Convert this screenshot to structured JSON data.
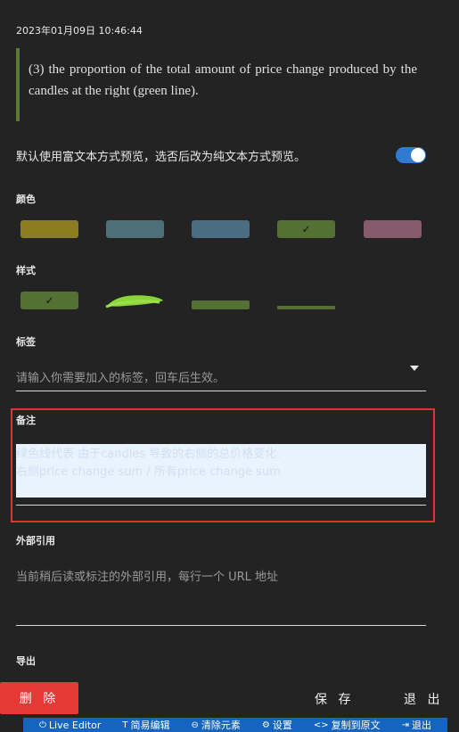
{
  "timestamp": "2023年01月09日 10:46:44",
  "quote": "(3) the proportion of the total amount of price change produced by the candles at the right (green line).",
  "preview_pref": {
    "text": "默认使用富文本方式预览，选否后改为纯文本方式预览。",
    "enabled": true
  },
  "colors_section": {
    "label": "颜色",
    "swatches": [
      {
        "name": "olive",
        "color": "#8a7d22",
        "selected": false
      },
      {
        "name": "slate-teal",
        "color": "#4d6f78",
        "selected": false
      },
      {
        "name": "steel-blue",
        "color": "#4b6d84",
        "selected": false
      },
      {
        "name": "moss-green",
        "color": "#557033",
        "selected": true
      },
      {
        "name": "mauve",
        "color": "#845a6c",
        "selected": false
      }
    ],
    "check_mark": "✓"
  },
  "style_section": {
    "label": "样式",
    "options": [
      "solid-box",
      "brush-highlight",
      "thick-underline",
      "thin-underline"
    ],
    "selected": "solid-box",
    "check_mark": "✓"
  },
  "tags_section": {
    "label": "标签",
    "placeholder": "请输入你需要加入的标签，回车后生效。"
  },
  "note_section": {
    "label": "备注",
    "lines": [
      "绿色线代表 由于candles 导致的右侧的总价格变化.",
      "右侧price change sum / 所有price change sum"
    ]
  },
  "external_refs_section": {
    "label": "外部引用",
    "placeholder": "当前稍后读或标注的外部引用，每行一个 URL 地址"
  },
  "export_section": {
    "label": "导出"
  },
  "actions": {
    "delete": "删 除",
    "save": "保 存",
    "exit": "退 出"
  },
  "bottom_bar": {
    "items": [
      {
        "icon": "⏻",
        "label": "Live Editor"
      },
      {
        "icon": "T",
        "label": "简易编辑"
      },
      {
        "icon": "⊖",
        "label": "清除元素"
      },
      {
        "icon": "⚙",
        "label": "设置"
      },
      {
        "icon": "<>",
        "label": "复制到原文"
      },
      {
        "icon": "⇥",
        "label": "退出"
      }
    ]
  }
}
